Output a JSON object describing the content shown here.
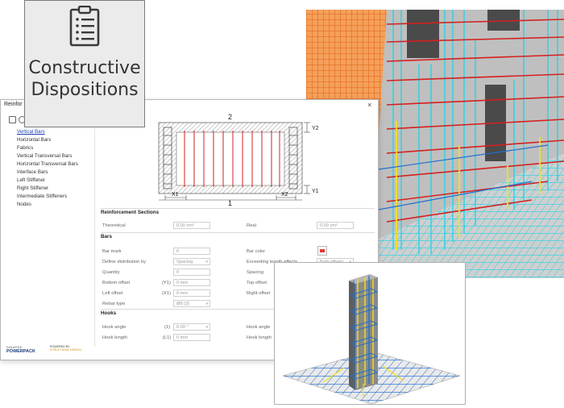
{
  "header": {
    "title_line1": "Constructive",
    "title_line2": "Dispositions",
    "icon": "clipboard-icon"
  },
  "dialog": {
    "title": "Reinfor",
    "close": "×",
    "sidebar": {
      "items": [
        {
          "label": "Vertical Bars",
          "selected": true
        },
        {
          "label": "Horizontal Bars"
        },
        {
          "label": "Fabrics"
        },
        {
          "label": "Vertical Transversal Bars"
        },
        {
          "label": "Horizontal Transversal Bars"
        },
        {
          "label": "Interface Bars"
        },
        {
          "label": "Left Stiffener"
        },
        {
          "label": "Right Stiffener"
        },
        {
          "label": "Intermediate Stiffeners"
        },
        {
          "label": "Nodes"
        }
      ]
    },
    "drawing": {
      "label_top": "2",
      "label_bottom": "1",
      "dim_y2": "Y2",
      "dim_y1": "Y1",
      "dim_x1": "X1",
      "dim_x2": "X2"
    },
    "reinforcement_sections": {
      "heading": "Reinforcement Sections",
      "theoretical_label": "Theoretical",
      "theoretical_value": "0.00 cm²",
      "real_label": "Real",
      "real_value": "0.00 cm²"
    },
    "bars": {
      "heading": "Bars",
      "bar_mark_label": "Bar mark",
      "bar_mark_value": "0",
      "distribution_label": "Define distribution by",
      "distribution_value": "Spacing",
      "quantity_label": "Quantity",
      "quantity_value": "0",
      "bottom_offset_label": "Bottom offset",
      "bottom_offset_code": "(Y1)",
      "bottom_offset_value": "0 mm",
      "left_offset_label": "Left offset",
      "left_offset_code": "(X1)",
      "left_offset_value": "0 mm",
      "rebar_type_label": "Rebar type",
      "rebar_type_value": "Ø8 (3)",
      "bar_color_label": "Bar color",
      "bar_color_swatch": "#e03a3a",
      "exceeding_label": "Exceeding length effects",
      "exceeding_value": "Both offsets",
      "spacing_label": "Spacing",
      "top_offset_label": "Top offset",
      "right_offset_label": "Right offset"
    },
    "hooks": {
      "heading": "Hooks",
      "hook_angle_label": "Hook angle",
      "hook_angle_code": "(1)",
      "hook_angle_value": "0.00 °",
      "hook_length_label": "Hook length",
      "hook_length_code": "(L1)",
      "hook_length_value": "0 mm",
      "hook_angle2_label": "Hook angle",
      "hook_length2_label": "Hook length"
    }
  },
  "logos": {
    "logo1_line1": "SINAPSE",
    "logo1_line2": "POWERPACK",
    "logo2_line1": "POWERED BY",
    "logo2_line2": "STRUCTURAL DESIGN"
  },
  "colors": {
    "accent": "#1a3fb5",
    "rebar_red": "#d42020",
    "rebar_cyan": "#27d3e6",
    "rebar_yellow": "#f2e21a",
    "rebar_orange": "#f08a2a",
    "column_blue": "#1f6fd1"
  }
}
